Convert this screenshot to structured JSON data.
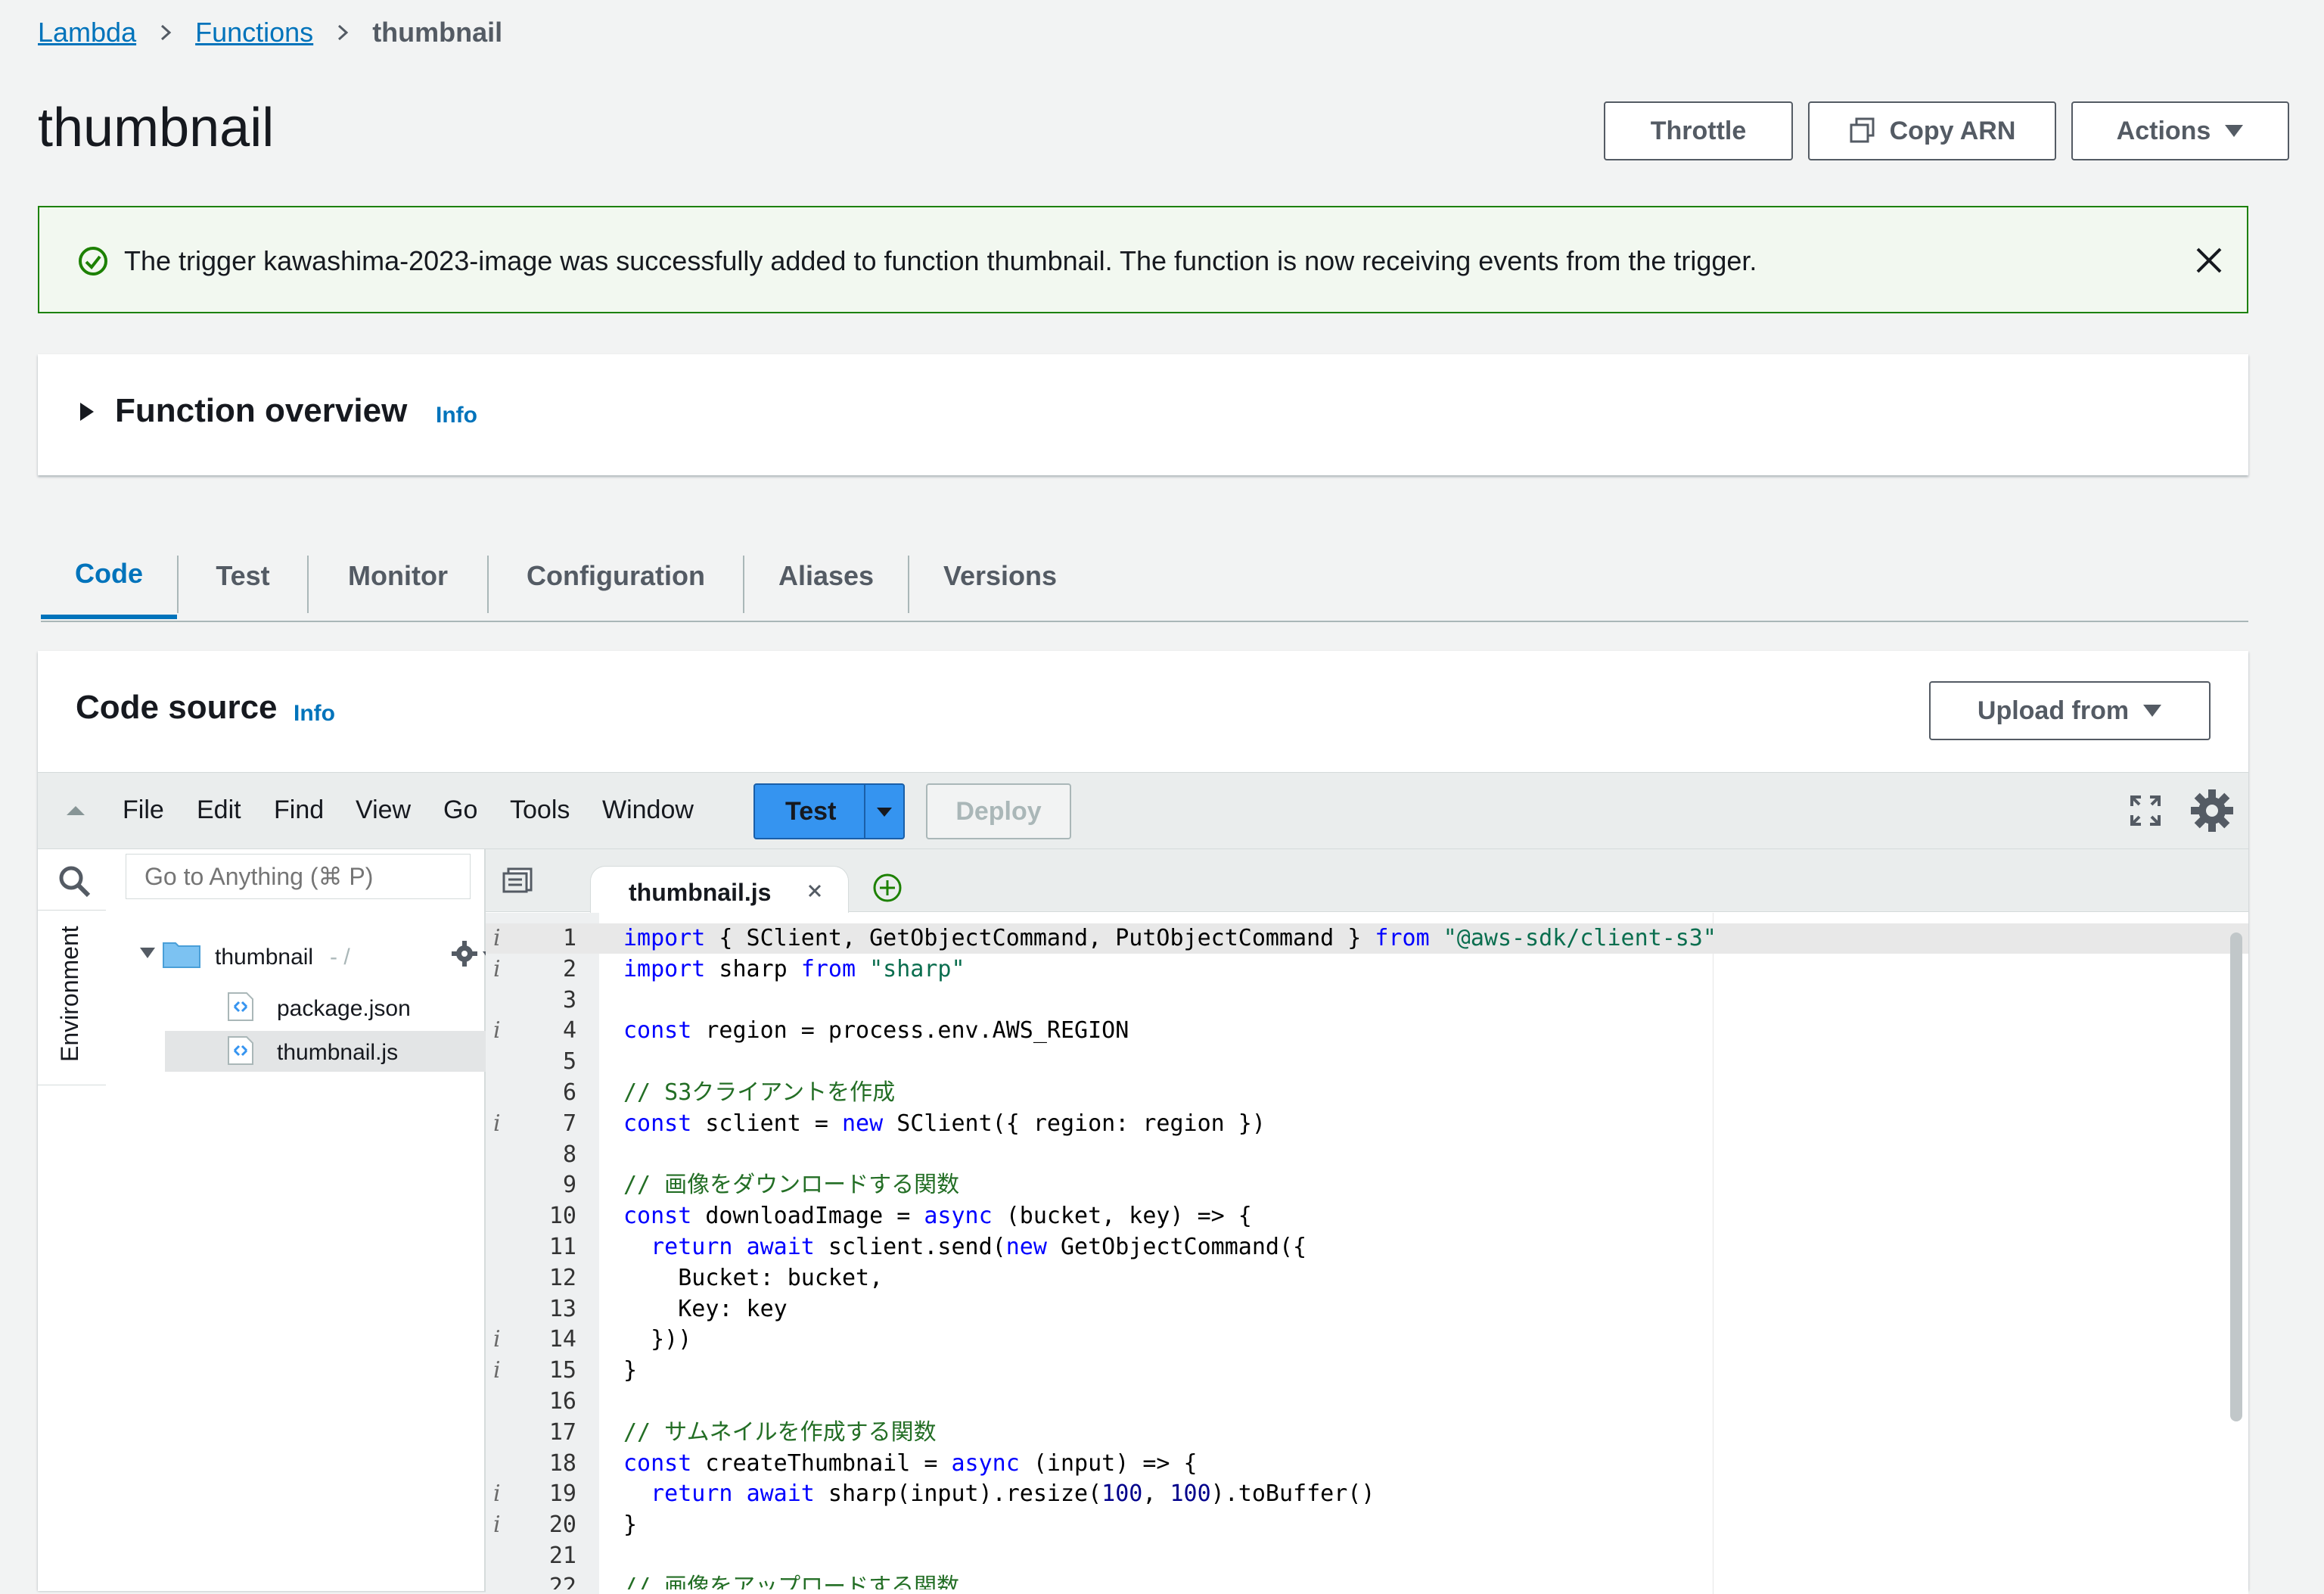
{
  "breadcrumb": {
    "item1": "Lambda",
    "item2": "Functions",
    "current": "thumbnail"
  },
  "page": {
    "title": "thumbnail"
  },
  "header_buttons": {
    "throttle": "Throttle",
    "copy_arn": "Copy ARN",
    "actions": "Actions"
  },
  "flash": {
    "message": "The trigger kawashima-2023-image was successfully added to function thumbnail. The function is now receiving events from the trigger."
  },
  "overview": {
    "title": "Function overview",
    "info": "Info"
  },
  "tabs": [
    "Code",
    "Test",
    "Monitor",
    "Configuration",
    "Aliases",
    "Versions"
  ],
  "code_source": {
    "title": "Code source",
    "info": "Info",
    "upload": "Upload from"
  },
  "ide": {
    "menu": [
      "File",
      "Edit",
      "Find",
      "View",
      "Go",
      "Tools",
      "Window"
    ],
    "test": "Test",
    "deploy": "Deploy",
    "goto_placeholder": "Go to Anything (⌘ P)",
    "env_label": "Environment",
    "tree": {
      "folder": "thumbnail",
      "folder_suffix": " - /",
      "file1": "package.json",
      "file2": "thumbnail.js"
    },
    "open_tab": "thumbnail.js"
  },
  "code_lines": [
    {
      "n": "1",
      "mark": "i",
      "text": "import { S3Client, GetObjectCommand, PutObjectCommand } from \"@aws-sdk/client-s3\""
    },
    {
      "n": "2",
      "mark": "i",
      "text": "import sharp from \"sharp\""
    },
    {
      "n": "3",
      "mark": "",
      "text": ""
    },
    {
      "n": "4",
      "mark": "i",
      "text": "const region = process.env.AWS_REGION"
    },
    {
      "n": "5",
      "mark": "",
      "text": ""
    },
    {
      "n": "6",
      "mark": "",
      "text": "// S3クライアントを作成"
    },
    {
      "n": "7",
      "mark": "i",
      "text": "const s3client = new S3Client({ region: region })"
    },
    {
      "n": "8",
      "mark": "",
      "text": ""
    },
    {
      "n": "9",
      "mark": "",
      "text": "// 画像をダウンロードする関数"
    },
    {
      "n": "10",
      "mark": "",
      "text": "const downloadImage = async (bucket, key) => {"
    },
    {
      "n": "11",
      "mark": "",
      "text": "  return await s3client.send(new GetObjectCommand({"
    },
    {
      "n": "12",
      "mark": "",
      "text": "    Bucket: bucket,"
    },
    {
      "n": "13",
      "mark": "",
      "text": "    Key: key"
    },
    {
      "n": "14",
      "mark": "i",
      "text": "  }))"
    },
    {
      "n": "15",
      "mark": "i",
      "text": "}"
    },
    {
      "n": "16",
      "mark": "",
      "text": ""
    },
    {
      "n": "17",
      "mark": "",
      "text": "// サムネイルを作成する関数"
    },
    {
      "n": "18",
      "mark": "",
      "text": "const createThumbnail = async (input) => {"
    },
    {
      "n": "19",
      "mark": "i",
      "text": "  return await sharp(input).resize(100, 100).toBuffer()"
    },
    {
      "n": "20",
      "mark": "i",
      "text": "}"
    },
    {
      "n": "21",
      "mark": "",
      "text": ""
    },
    {
      "n": "22",
      "mark": "",
      "text": "// 画像をアップロードする関数"
    }
  ]
}
